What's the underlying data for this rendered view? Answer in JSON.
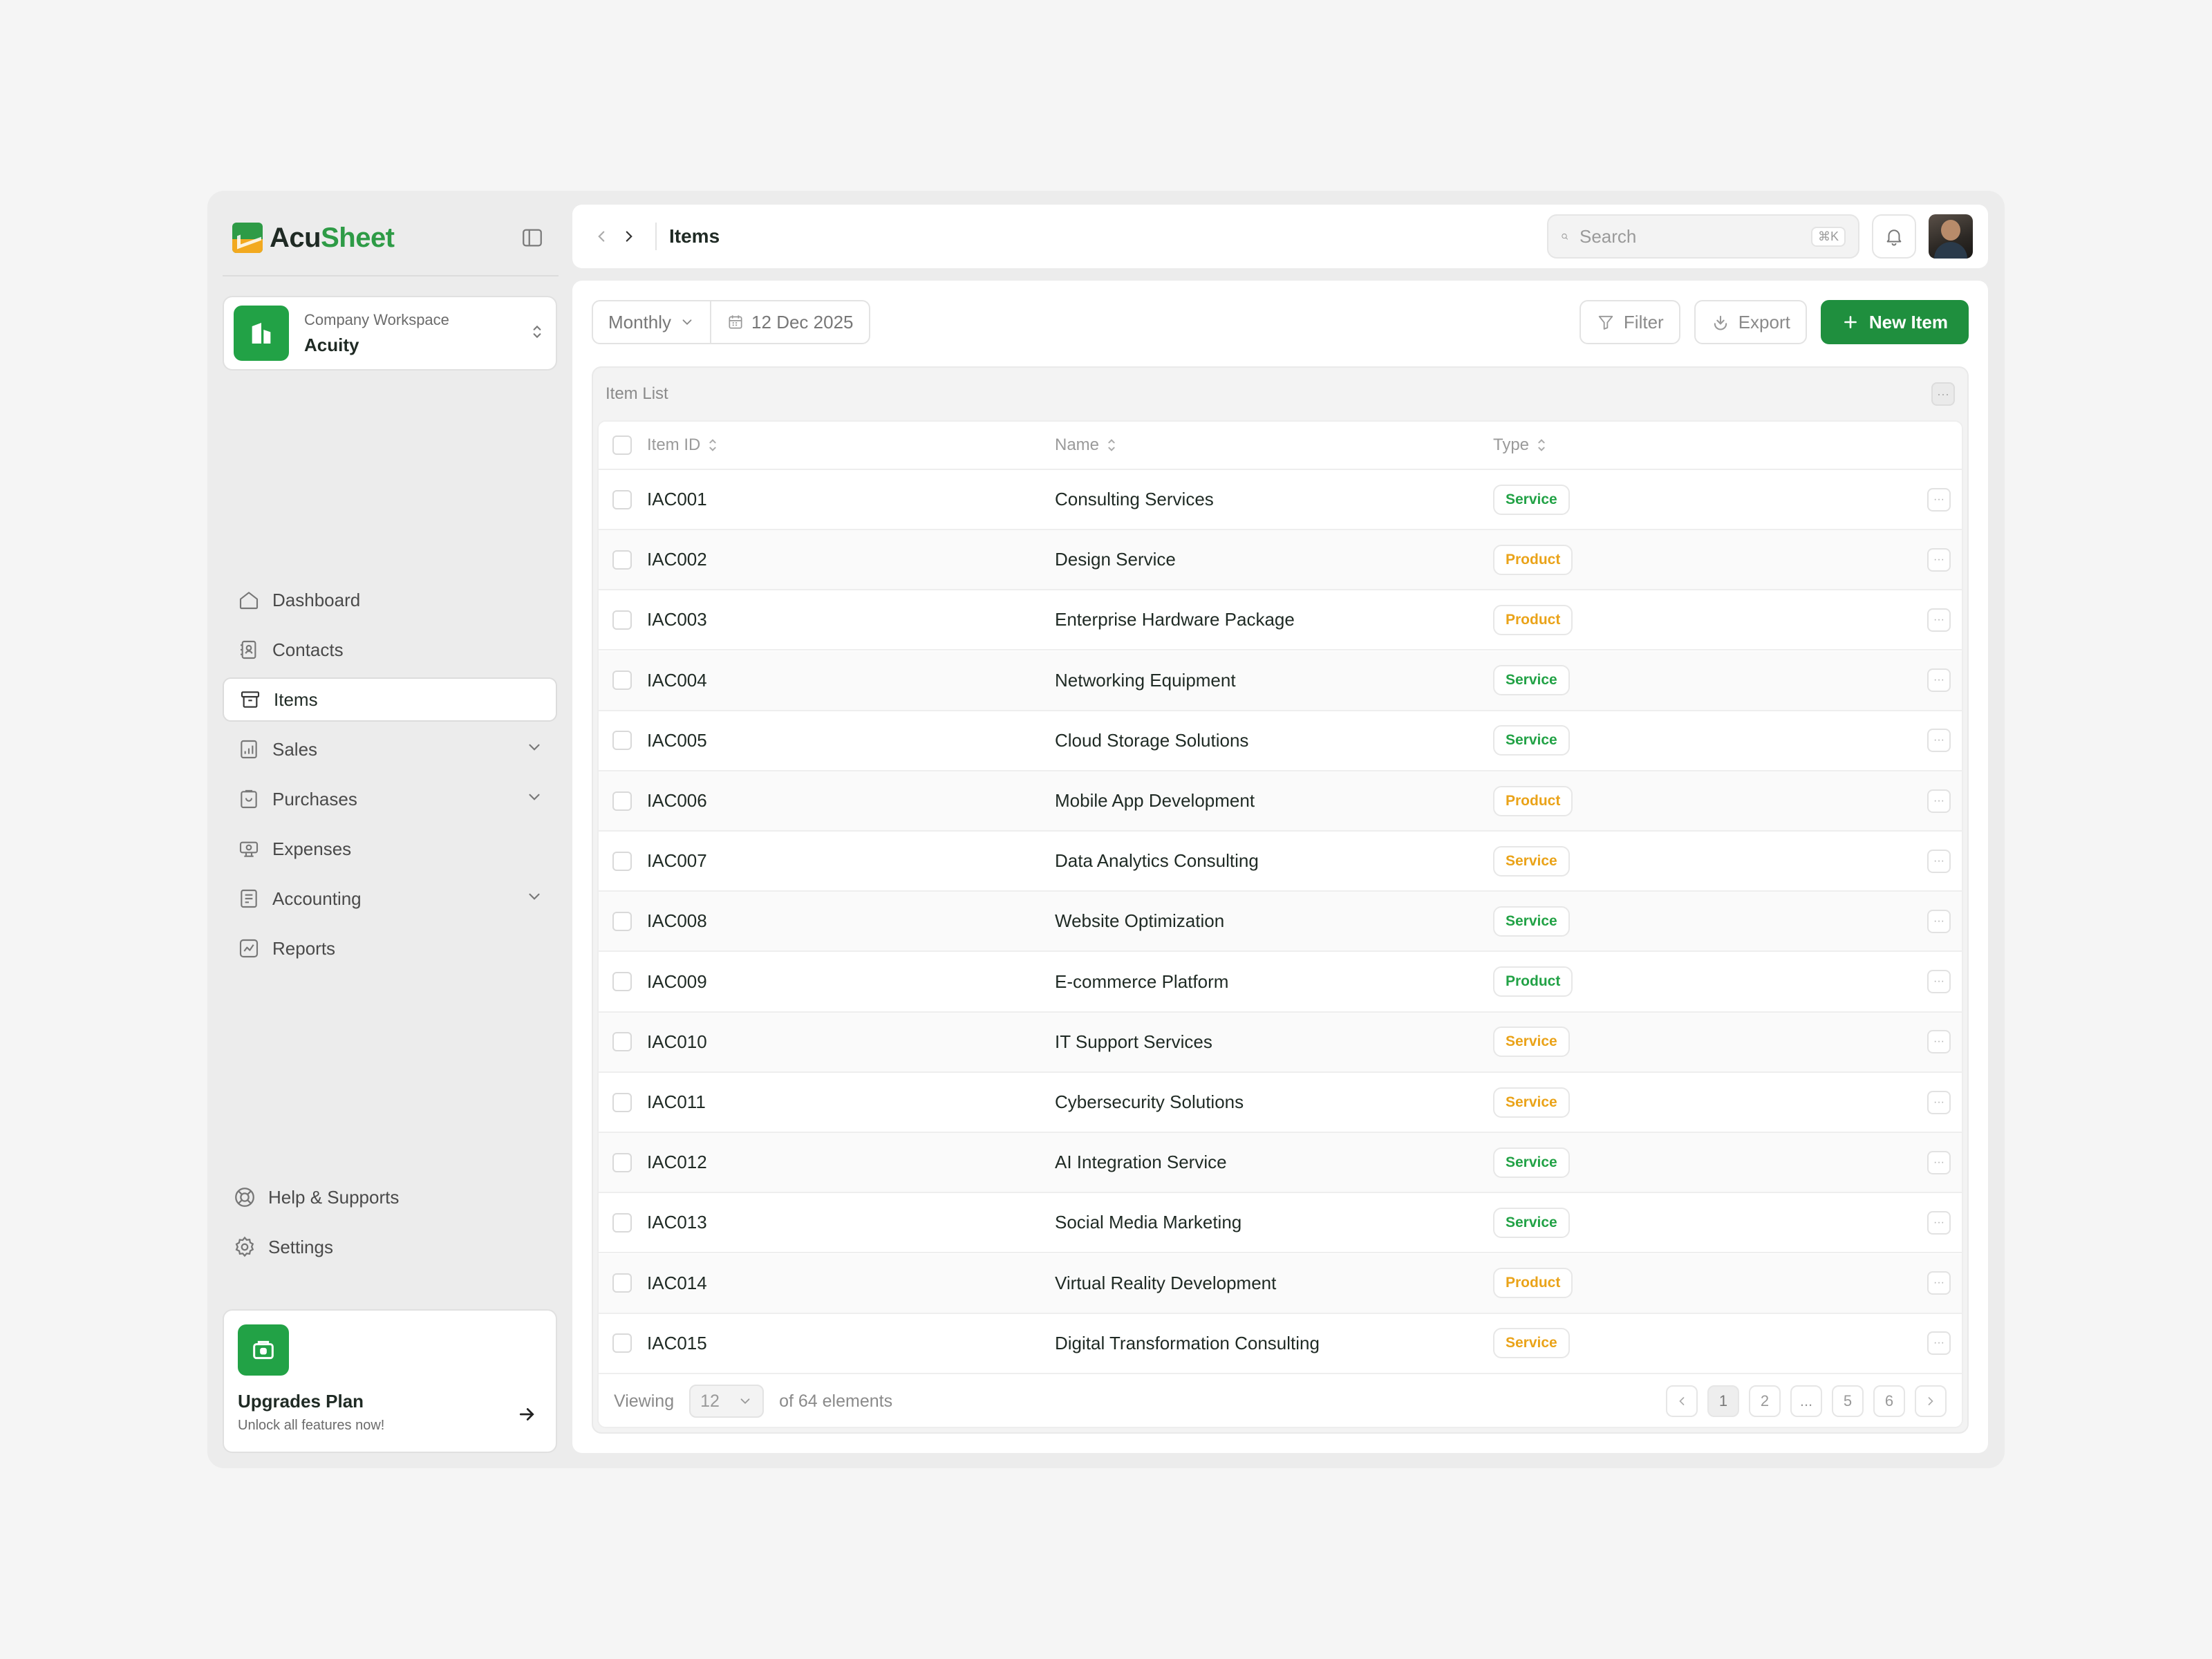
{
  "brand": {
    "name_part1": "Acu",
    "name_part2": "Sheet"
  },
  "workspace": {
    "subtitle": "Company Workspace",
    "name": "Acuity"
  },
  "nav": {
    "dashboard": "Dashboard",
    "contacts": "Contacts",
    "items": "Items",
    "sales": "Sales",
    "purchases": "Purchases",
    "expenses": "Expenses",
    "accounting": "Accounting",
    "reports": "Reports",
    "help": "Help & Supports",
    "settings": "Settings"
  },
  "upgrade": {
    "title": "Upgrades Plan",
    "subtitle": "Unlock all features now!"
  },
  "topbar": {
    "title": "Items",
    "search_placeholder": "Search",
    "shortcut": "⌘K"
  },
  "toolbar": {
    "period": "Monthly",
    "date": "12 Dec 2025",
    "filter": "Filter",
    "export": "Export",
    "new_item": "New Item"
  },
  "card": {
    "title": "Item List"
  },
  "table": {
    "headers": {
      "id": "Item ID",
      "name": "Name",
      "type": "Type"
    },
    "rows": [
      {
        "id": "IAC001",
        "name": "Consulting Services",
        "type": "Service",
        "type_color": "#22a246"
      },
      {
        "id": "IAC002",
        "name": "Design Service",
        "type": "Product",
        "type_color": "#eaa319"
      },
      {
        "id": "IAC003",
        "name": "Enterprise Hardware Package",
        "type": "Product",
        "type_color": "#eaa319"
      },
      {
        "id": "IAC004",
        "name": "Networking Equipment",
        "type": "Service",
        "type_color": "#22a246"
      },
      {
        "id": "IAC005",
        "name": "Cloud Storage Solutions",
        "type": "Service",
        "type_color": "#22a246"
      },
      {
        "id": "IAC006",
        "name": "Mobile App Development",
        "type": "Product",
        "type_color": "#eaa319"
      },
      {
        "id": "IAC007",
        "name": "Data Analytics Consulting",
        "type": "Service",
        "type_color": "#eaa319"
      },
      {
        "id": "IAC008",
        "name": "Website Optimization",
        "type": "Service",
        "type_color": "#22a246"
      },
      {
        "id": "IAC009",
        "name": "E-commerce Platform",
        "type": "Product",
        "type_color": "#22a246"
      },
      {
        "id": "IAC010",
        "name": "IT Support Services",
        "type": "Service",
        "type_color": "#eaa319"
      },
      {
        "id": "IAC011",
        "name": "Cybersecurity Solutions",
        "type": "Service",
        "type_color": "#eaa319"
      },
      {
        "id": "IAC012",
        "name": "AI Integration Service",
        "type": "Service",
        "type_color": "#22a246"
      },
      {
        "id": "IAC013",
        "name": "Social Media Marketing",
        "type": "Service",
        "type_color": "#22a246"
      },
      {
        "id": "IAC014",
        "name": "Virtual Reality Development",
        "type": "Product",
        "type_color": "#eaa319"
      },
      {
        "id": "IAC015",
        "name": "Digital Transformation Consulting",
        "type": "Service",
        "type_color": "#eaa319"
      }
    ]
  },
  "footer": {
    "viewing": "Viewing",
    "per_page": "12",
    "of_total": "of 64 elements",
    "pages": [
      "1",
      "2",
      "...",
      "5",
      "6"
    ],
    "current_page": "1"
  },
  "colors": {
    "accent": "#1f8f3e",
    "service_green": "#22a246",
    "product_amber": "#eaa319"
  }
}
